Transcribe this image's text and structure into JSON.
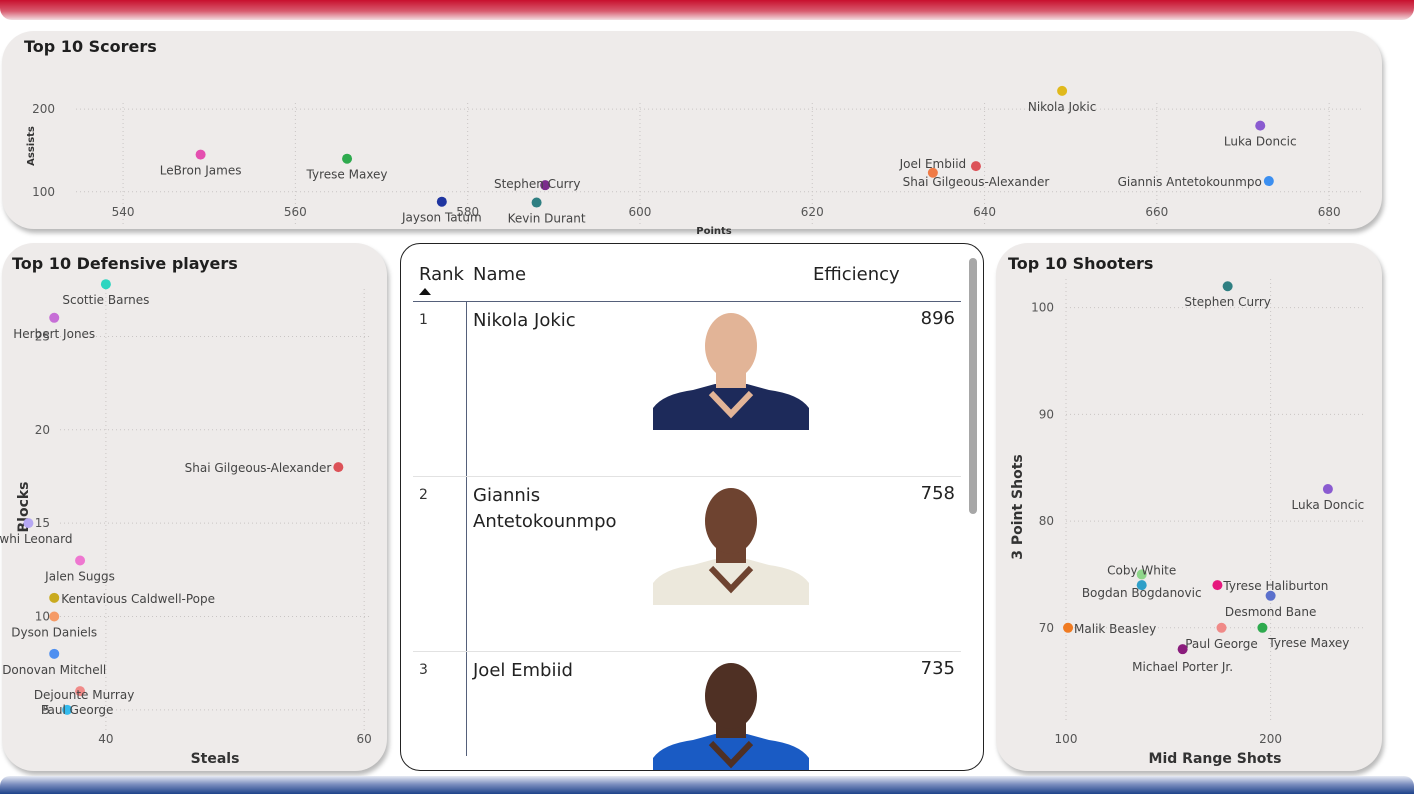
{
  "colors": {
    "top_band": "#c8102e",
    "bottom_band": "#1d428a",
    "card_bg": "#eeebea"
  },
  "scorers": {
    "title": "Top 10 Scorers",
    "chart_data": {
      "type": "scatter",
      "xlabel": "Points",
      "ylabel": "Assists",
      "xlim": [
        535,
        683
      ],
      "ylim": [
        55,
        240
      ],
      "xticks": [
        "540",
        "560",
        "580",
        "600",
        "620",
        "640",
        "660",
        "680"
      ],
      "yticks": [
        "100",
        "200"
      ],
      "grid": true,
      "points": [
        {
          "name": "LeBron James",
          "x": 549,
          "y": 145,
          "color": "#e44fb0"
        },
        {
          "name": "Tyrese Maxey",
          "x": 566,
          "y": 140,
          "color": "#2eaa4e"
        },
        {
          "name": "Jayson Tatum",
          "x": 577,
          "y": 88,
          "color": "#1f35a0"
        },
        {
          "name": "Stephen Curry",
          "x": 589,
          "y": 108,
          "color": "#7b2b8c"
        },
        {
          "name": "Kevin Durant",
          "x": 588,
          "y": 87,
          "color": "#2f7f82"
        },
        {
          "name": "Joel Embiid",
          "x": 634,
          "y": 123,
          "color": "#ef7a45"
        },
        {
          "name": "Shai Gilgeous-Alexander",
          "x": 639,
          "y": 131,
          "color": "#dc5258"
        },
        {
          "name": "Nikola Jokic",
          "x": 649,
          "y": 222,
          "color": "#e0b91c"
        },
        {
          "name": "Luka Doncic",
          "x": 672,
          "y": 180,
          "color": "#8a5bd0"
        },
        {
          "name": "Giannis Antetokounmpo",
          "x": 673,
          "y": 113,
          "color": "#3c8ff0"
        }
      ]
    }
  },
  "defensive": {
    "title": "Top 10 Defensive players",
    "chart_data": {
      "type": "scatter",
      "xlabel": "Steals",
      "ylabel": "Blocks",
      "xlim": [
        27,
        62
      ],
      "ylim": [
        4,
        27.8
      ],
      "xticks": [
        "40",
        "60"
      ],
      "yticks": [
        "5",
        "10",
        "15",
        "20",
        "25"
      ],
      "grid": true,
      "points": [
        {
          "name": "Scottie Barnes",
          "x": 40,
          "y": 27.8,
          "color": "#2ed5c0"
        },
        {
          "name": "Herbert Jones",
          "x": 36,
          "y": 26,
          "color": "#c66ed6"
        },
        {
          "name": "Shai Gilgeous-Alexander",
          "x": 58,
          "y": 18,
          "color": "#dc5258"
        },
        {
          "name": "Kawhi Leonard",
          "x": 34,
          "y": 15,
          "color": "#b6a8f3"
        },
        {
          "name": "Jalen Suggs",
          "x": 38,
          "y": 13,
          "color": "#ee77d0"
        },
        {
          "name": "Kentavious Caldwell-Pope",
          "x": 36,
          "y": 11,
          "color": "#c9aa1e"
        },
        {
          "name": "Dyson Daniels",
          "x": 36,
          "y": 10,
          "color": "#f59a66"
        },
        {
          "name": "Donovan Mitchell",
          "x": 36,
          "y": 8,
          "color": "#4e8ff0"
        },
        {
          "name": "Dejounte Murray",
          "x": 38,
          "y": 6,
          "color": "#f08a88"
        },
        {
          "name": "Paul George",
          "x": 37,
          "y": 5,
          "color": "#33bbee"
        }
      ]
    }
  },
  "shooters": {
    "title": "Top 10 Shooters",
    "chart_data": {
      "type": "scatter",
      "xlabel": "Mid Range Shots",
      "ylabel": "3 Point Shots",
      "xlim": [
        100,
        230
      ],
      "ylim": [
        66,
        104
      ],
      "xticks": [
        "100",
        "200"
      ],
      "yticks": [
        "70",
        "80",
        "90",
        "100"
      ],
      "grid": true,
      "points": [
        {
          "name": "Stephen Curry",
          "x": 179,
          "y": 102,
          "color": "#2f7f82"
        },
        {
          "name": "Luka Doncic",
          "x": 228,
          "y": 83,
          "color": "#8a5bd0"
        },
        {
          "name": "Coby White",
          "x": 137,
          "y": 75,
          "color": "#8fd68a"
        },
        {
          "name": "Bogdan Bogdanovic",
          "x": 137,
          "y": 74,
          "color": "#2f9fc8"
        },
        {
          "name": "Tyrese Haliburton",
          "x": 174,
          "y": 74,
          "color": "#e6187e"
        },
        {
          "name": "Desmond Bane",
          "x": 200,
          "y": 73,
          "color": "#5b70cc"
        },
        {
          "name": "Malik Beasley",
          "x": 101,
          "y": 70,
          "color": "#f07b22"
        },
        {
          "name": "Paul George",
          "x": 176,
          "y": 70,
          "color": "#f08a88"
        },
        {
          "name": "Tyrese Maxey",
          "x": 196,
          "y": 70,
          "color": "#2eaa4e"
        },
        {
          "name": "Michael Porter Jr.",
          "x": 157,
          "y": 68,
          "color": "#8a1c7c"
        }
      ]
    }
  },
  "efficiency_table": {
    "columns": {
      "rank": "Rank",
      "name": "Name",
      "efficiency": "Efficiency"
    },
    "rows": [
      {
        "rank": "1",
        "name": "Nikola Jokic",
        "efficiency": "896",
        "jersey": "#1d2a5a",
        "skin": "#e2b497"
      },
      {
        "rank": "2",
        "name": "Giannis Antetokounmpo",
        "efficiency": "758",
        "jersey": "#ece8dc",
        "skin": "#6e4330"
      },
      {
        "rank": "3",
        "name": "Joel Embiid",
        "efficiency": "735",
        "jersey": "#1a5bc4",
        "skin": "#4f3024"
      }
    ]
  }
}
